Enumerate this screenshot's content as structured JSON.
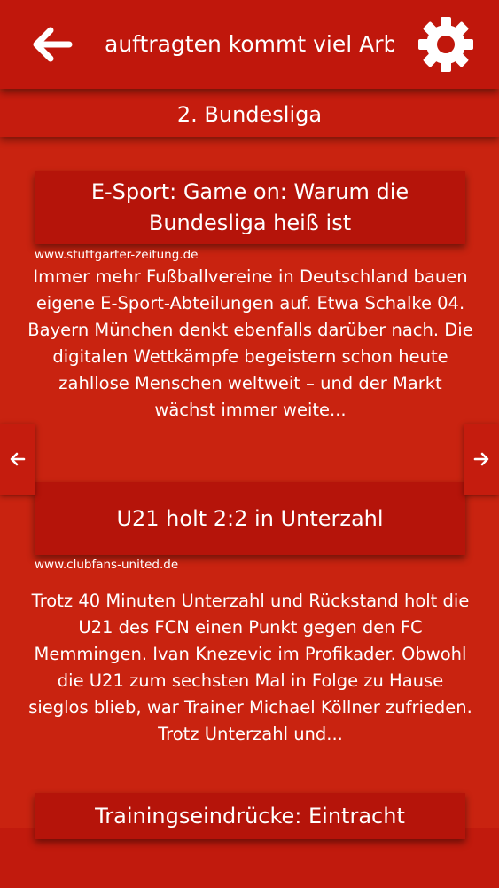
{
  "header": {
    "back_icon": "arrow-left-icon",
    "scrolling_title": "auftragten kommt viel Arbeit zu",
    "settings_icon": "gear-icon"
  },
  "section": {
    "title": "2. Bundesliga"
  },
  "articles": [
    {
      "title": "E-Sport: Game on: Warum die Bundesliga heiß ist",
      "source": "www.stuttgarter-zeitung.de",
      "summary": "Immer mehr Fußballvereine in Deutschland bauen eigene E-Sport-Abteilungen auf. Etwa Schalke 04. Bayern München denkt ebenfalls darüber nach. Die digitalen Wettkämpfe begeistern schon heute zahllose Menschen weltweit – und der Markt wächst immer weite..."
    },
    {
      "title": "U21 holt 2:2 in Unterzahl",
      "source": "www.clubfans-united.de",
      "summary": "Trotz 40 Minuten Unterzahl und Rückstand holt die U21 des FCN einen Punkt gegen den FC Memmingen. Ivan Knezevic im Profikader. Obwohl die U21 zum sechsten Mal in Folge zu Hause sieglos blieb, war Trainer Michael Köllner zufrieden. Trotz Unterzahl und..."
    },
    {
      "title": "Trainingseindrücke: Eintracht"
    }
  ],
  "nav": {
    "prev_icon": "arrow-left-small-icon",
    "next_icon": "arrow-right-small-icon"
  },
  "colors": {
    "background": "#c92310",
    "card": "#b5140a",
    "text": "#ffffff"
  }
}
